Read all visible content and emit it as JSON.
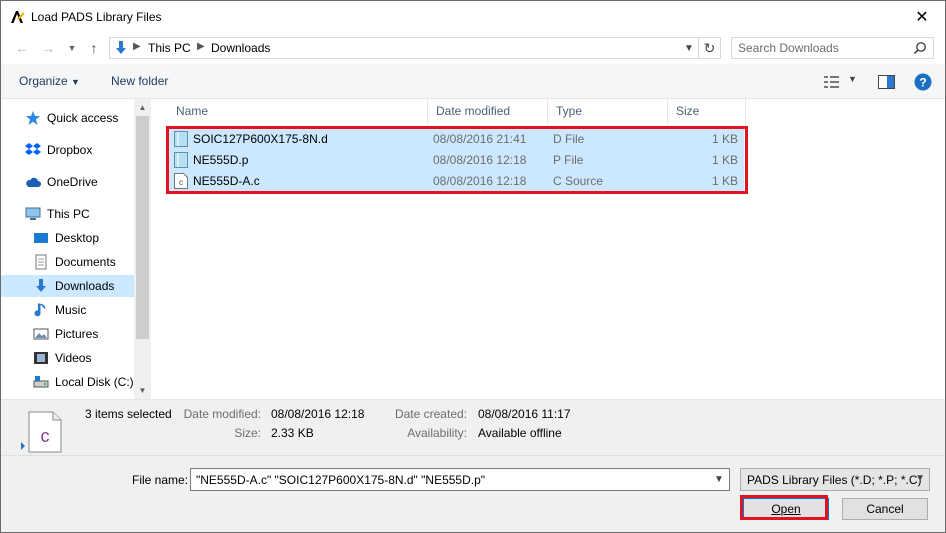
{
  "window": {
    "title": "Load PADS Library Files",
    "close_glyph": "✕"
  },
  "address": {
    "crumbs": [
      "This PC",
      "Downloads"
    ],
    "search_placeholder": "Search Downloads"
  },
  "toolbar": {
    "organize": "Organize",
    "new_folder": "New folder"
  },
  "nav": {
    "items": [
      {
        "label": "Quick access",
        "icon": "star-icon"
      },
      {
        "label": "Dropbox",
        "icon": "dropbox-icon"
      },
      {
        "label": "OneDrive",
        "icon": "cloud-icon"
      },
      {
        "label": "This PC",
        "icon": "computer-icon"
      },
      {
        "label": "Desktop",
        "icon": "desktop-icon"
      },
      {
        "label": "Documents",
        "icon": "documents-icon"
      },
      {
        "label": "Downloads",
        "icon": "download-icon",
        "selected": true
      },
      {
        "label": "Music",
        "icon": "music-icon"
      },
      {
        "label": "Pictures",
        "icon": "pictures-icon"
      },
      {
        "label": "Videos",
        "icon": "videos-icon"
      },
      {
        "label": "Local Disk (C:)",
        "icon": "disk-icon"
      }
    ]
  },
  "columns": {
    "name": "Name",
    "date": "Date modified",
    "type": "Type",
    "size": "Size"
  },
  "files": [
    {
      "name": "SOIC127P600X175-8N.d",
      "date": "08/08/2016 21:41",
      "type": "D File",
      "size": "1 KB"
    },
    {
      "name": "NE555D.p",
      "date": "08/08/2016 12:18",
      "type": "P File",
      "size": "1 KB"
    },
    {
      "name": "NE555D-A.c",
      "date": "08/08/2016 12:18",
      "type": "C Source",
      "size": "1 KB"
    }
  ],
  "details": {
    "summary": "3 items selected",
    "date_modified_label": "Date modified:",
    "date_modified": "08/08/2016 12:18",
    "size_label": "Size:",
    "size": "2.33 KB",
    "date_created_label": "Date created:",
    "date_created": "08/08/2016 11:17",
    "availability_label": "Availability:",
    "availability": "Available offline"
  },
  "bottom": {
    "file_name_label": "File name:",
    "file_name_value": "\"NE555D-A.c\" \"SOIC127P600X175-8N.d\" \"NE555D.p\"",
    "filter": "PADS Library Files (*.D; *.P; *.C)",
    "open": "Open",
    "cancel": "Cancel"
  },
  "colors": {
    "selection": "#cce8ff",
    "highlight_box": "#e0141e",
    "accent": "#0078d7"
  }
}
